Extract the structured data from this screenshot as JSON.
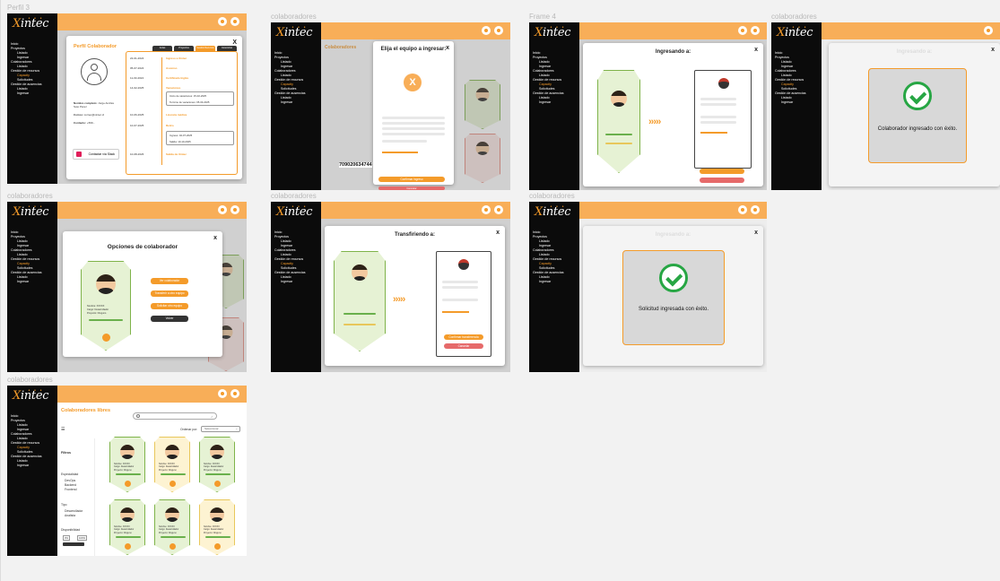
{
  "frames": {
    "f1": "Perfil 3",
    "f2": "colaboradores",
    "f3": "Frame 4",
    "f4": "colaboradores",
    "f5": "colaboradores",
    "f6": "colaboradores",
    "f7": "colaboradores",
    "f8": "colaboradores"
  },
  "logo": "intec",
  "logo_x": "X",
  "nav": {
    "inicio": "Inicio",
    "proyectos": "Proyectos",
    "listado": "Listado",
    "ingresar": "Ingresar",
    "colaboradores": "Colaboradores",
    "gestion_recursos": "Gestión de recursos",
    "capacity": "Capacity",
    "solicitudes": "Solicitudes",
    "gestion_ausencias": "Gestión de ausencias"
  },
  "page_title": "Colaboradores",
  "perfil": {
    "title": "Perfil Colaborador",
    "close": "X",
    "tabs": [
      "Actas",
      "Proyectos",
      "Gestión Recursos",
      "Ausencias"
    ],
    "name_label": "Nombre completo:",
    "name_value": "Jorge Andrés Soto Pérez",
    "correo_label": "Correo:",
    "correo_value": "correo@xintec.cl",
    "contacto_label": "Contacto:",
    "contacto_value": "+569...",
    "contact_button": "Contactar vía Slack",
    "timeline": [
      {
        "date": "22-01-2024",
        "text": "Ingreso a Xintec"
      },
      {
        "date": "05-07-2024",
        "text": "Ascenso"
      },
      {
        "date": "11-03-2024",
        "text": "Certificado Inglés"
      },
      {
        "date": "14-02-2025",
        "text": "Vacaciones"
      },
      {
        "date": "",
        "text": "Inicio de vacaciones: 15-02-2025"
      },
      {
        "date": "",
        "text": "Termino de vacaciones: 05-03-2025"
      },
      {
        "date": "10-06-2025",
        "text": "Licencia médica"
      },
      {
        "date": "10-07-2025",
        "text": "Retiro"
      },
      {
        "date": "",
        "text": "Ingreso: 02-07-2025"
      },
      {
        "date": "",
        "text": "Salida: 10-10-2025"
      },
      {
        "date": "10-08-2026",
        "text": "Salida de Xintec"
      }
    ]
  },
  "elija": {
    "title": "Elija el equipo a ingresar:",
    "close": "x",
    "number": "709020634744",
    "confirm": "Confirmar ingreso",
    "cancel": "Cancelar"
  },
  "ingresando": {
    "title": "Ingresando a:",
    "close": "x"
  },
  "exito1": {
    "title": "Ingresando a:",
    "close": "x",
    "message": "Colaborador ingresado con éxito."
  },
  "opciones": {
    "title": "Opciones de colaborador",
    "close": "x",
    "buttons": [
      "Ver colaborador",
      "Transferir a otro equipo",
      "Solicitar otro equipo",
      "Volver"
    ]
  },
  "transfiriendo": {
    "title": "Transfiriendo a:",
    "close": "x",
    "confirm": "Confirmar transferencia",
    "cancel": "Cancelar"
  },
  "exito2": {
    "title": "Ingresando a:",
    "close": "x",
    "message": "Solicitud ingresada con éxito."
  },
  "libres": {
    "title": "Colaboradores libres",
    "search_placeholder": "",
    "ordenar": "Ordenar por:",
    "ordenar_value": "Seleccionar",
    "filtros": "Filtros",
    "especialidad": "Especialidad",
    "esp_items": [
      "DevOps",
      "Backend",
      "Frontend"
    ],
    "tipo": "Tipo",
    "tipo_items": [
      "Desarrollador",
      "Analista"
    ],
    "disponibilidad": "Disponibilidad",
    "disp_min": "0%",
    "disp_max": "100%"
  },
  "card": {
    "nombre": "Nombre: XXXXX",
    "cargo": "Cargo: Desarrollador",
    "proyecto": "Proyecto: Ninguno"
  },
  "colors": {
    "accent": "#f49b2a",
    "topbar": "#f8ae58",
    "sidebar": "#0b0b0b",
    "success": "#27a644"
  }
}
